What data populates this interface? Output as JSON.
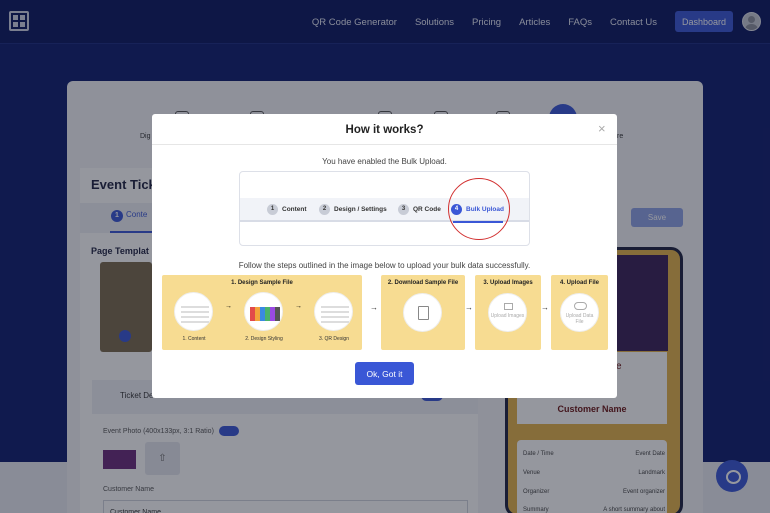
{
  "nav": {
    "items": [
      "QR Code Generator",
      "Solutions",
      "Pricing",
      "Articles",
      "FAQs",
      "Contact Us"
    ],
    "dashboard_label": "Dashboard"
  },
  "background": {
    "step_label_left": "Dig",
    "step_label_right": "re",
    "event_title": "Event Tick",
    "tab_active": "Conte",
    "tab_active_num": "1",
    "save_label": "Save",
    "page_template_label": "Page Templat",
    "ticket_details_label": "Ticket Details",
    "event_photo_label": "Event Photo (400x133px, 3:1 Ratio)",
    "customer_name_label": "Customer Name",
    "customer_name_value": "Customer Name",
    "phone_customer": "Customer Name",
    "phone_e": "e",
    "phone_rows": [
      {
        "k": "Date / Time",
        "v": "Event Date"
      },
      {
        "k": "Venue",
        "v": "Landmark"
      },
      {
        "k": "Organizer",
        "v": "Event organizer"
      },
      {
        "k": "Summary",
        "v": "A short summary about"
      }
    ]
  },
  "modal": {
    "title": "How it works?",
    "close_glyph": "×",
    "enabled_text": "You have enabled the Bulk Upload.",
    "demo_steps": [
      {
        "num": "1",
        "label": "Content"
      },
      {
        "num": "2",
        "label": "Design / Settings"
      },
      {
        "num": "3",
        "label": "QR Code"
      },
      {
        "num": "4",
        "label": "Bulk Upload"
      }
    ],
    "follow_text": "Follow the steps outlined in the image below to upload your bulk data successfully.",
    "panels": {
      "design": {
        "title": "1. Design Sample File",
        "sub": [
          "1. Content",
          "2. Design Styling",
          "3. QR Design"
        ]
      },
      "download": {
        "title": "2. Download Sample File"
      },
      "images": {
        "title": "3. Upload Images",
        "inner": "Upload Images"
      },
      "file": {
        "title": "4. Upload File",
        "inner": "Upload Data File"
      }
    },
    "arrow": "→",
    "ok_label": "Ok, Got it"
  }
}
